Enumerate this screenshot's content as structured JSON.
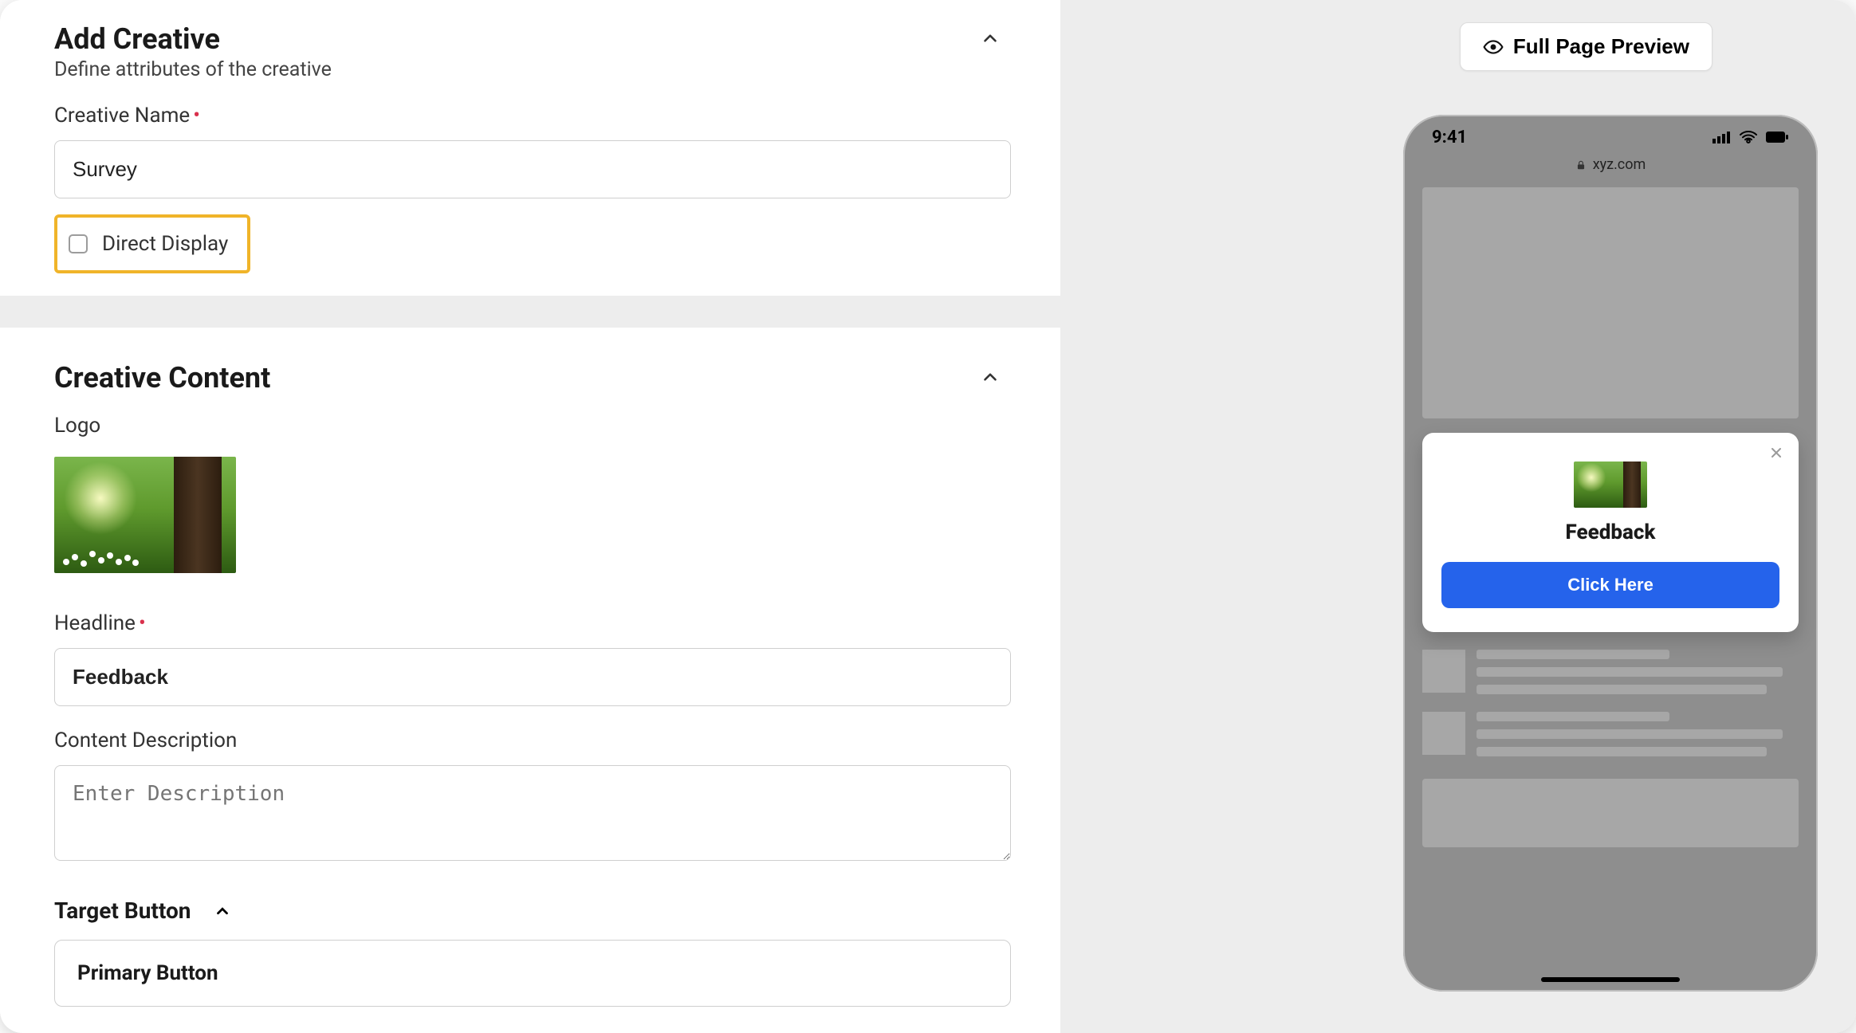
{
  "header": {
    "title": "Add Creative",
    "subtitle": "Define attributes of the creative"
  },
  "fields": {
    "creative_name_label": "Creative Name",
    "creative_name_value": "Survey",
    "direct_display_label": "Direct Display"
  },
  "content": {
    "title": "Creative Content",
    "logo_label": "Logo",
    "headline_label": "Headline",
    "headline_value": "Feedback",
    "description_label": "Content Description",
    "description_placeholder": "Enter Description"
  },
  "target": {
    "title": "Target Button",
    "primary_label": "Primary Button"
  },
  "right": {
    "preview_button": "Full Page Preview",
    "phone": {
      "time": "9:41",
      "url": "xyz.com",
      "modal_title": "Feedback",
      "cta_label": "Click Here"
    }
  }
}
